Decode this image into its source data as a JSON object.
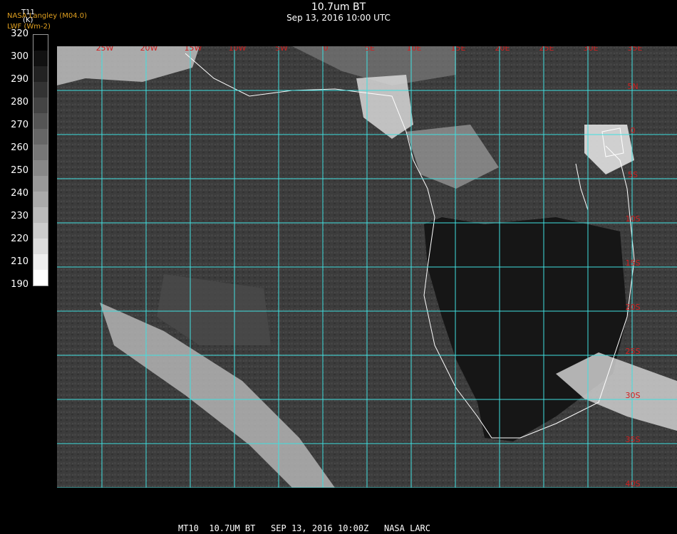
{
  "header": {
    "title": "10.7um BT",
    "subtitle": "Sep 13, 2016 10:00 UTC"
  },
  "credits": {
    "line1": "NASA Langley (M04.0)",
    "line2": "LWF (Wm-2)"
  },
  "colorbar": {
    "variable": "T11",
    "unit": "(K)",
    "ticks": [
      "320",
      "300",
      "290",
      "280",
      "270",
      "260",
      "250",
      "240",
      "230",
      "220",
      "210",
      "190"
    ]
  },
  "map": {
    "lon_labels": [
      "25W",
      "20W",
      "15W",
      "10W",
      "5W",
      "0",
      "5E",
      "10E",
      "15E",
      "20E",
      "25E",
      "30E",
      "35E"
    ],
    "lat_labels": [
      "5N",
      "0",
      "5S",
      "10S",
      "15S",
      "20S",
      "25S",
      "30S",
      "35S",
      "40S"
    ],
    "grid_color": "#40e0e0",
    "label_color": "#d02020",
    "coast_color": "#ffffff"
  },
  "footer": {
    "text": "MT10  10.7UM BT   SEP 13, 2016 10:00Z   NASA LARC"
  }
}
